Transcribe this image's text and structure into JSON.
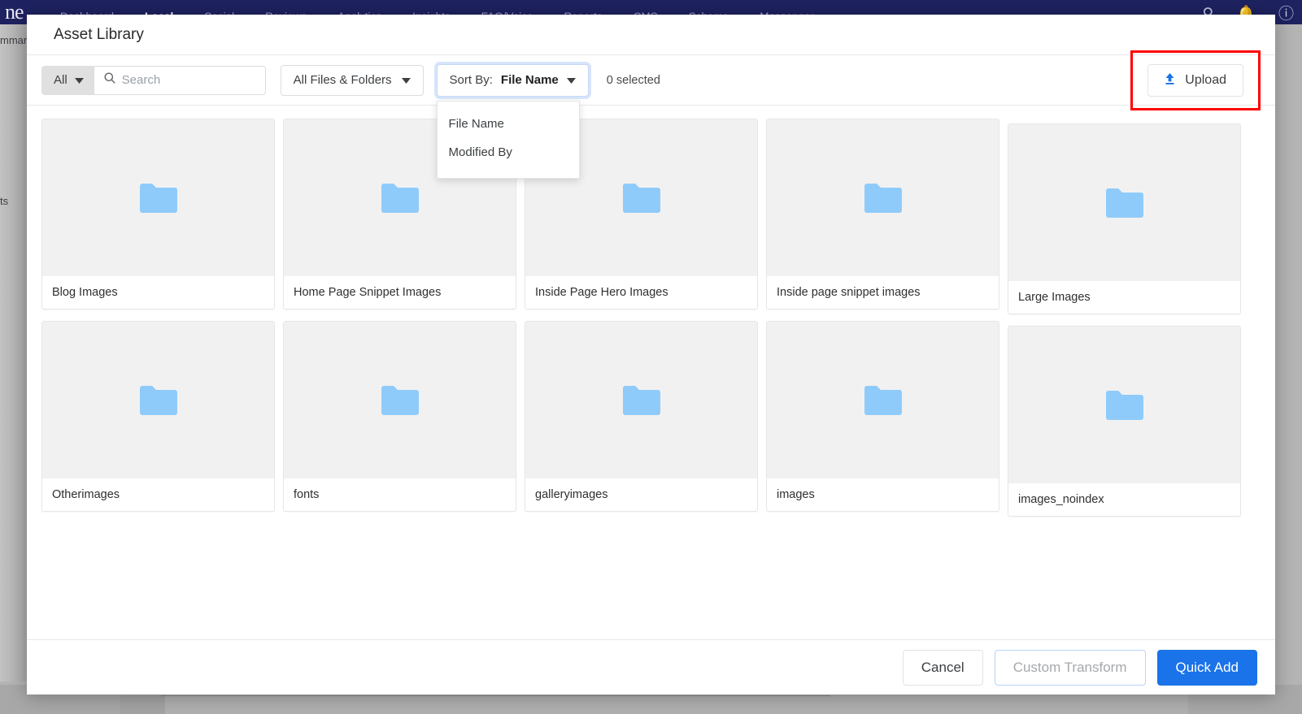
{
  "background": {
    "logo_text": "ne",
    "nav_items": [
      {
        "label": "Dashboard",
        "active": false
      },
      {
        "label": "Local",
        "active": true
      },
      {
        "label": "Social",
        "active": false
      },
      {
        "label": "Reviews",
        "active": false
      },
      {
        "label": "Analytics",
        "active": false
      },
      {
        "label": "Insights",
        "active": false
      },
      {
        "label": "FAQ/Voice",
        "active": false
      },
      {
        "label": "Reports",
        "active": false
      },
      {
        "label": "CMS",
        "active": false
      },
      {
        "label": "Scheme",
        "active": false
      },
      {
        "label": "Messenger",
        "active": false
      }
    ],
    "nav_icons": [
      "search-icon",
      "notification-bell-icon",
      "help-icon"
    ],
    "left_fragment_top": "mmar",
    "left_fragment_bottom": "ts"
  },
  "modal": {
    "title": "Asset Library",
    "toolbar": {
      "all_select_label": "All",
      "search_placeholder": "Search",
      "search_value": "",
      "filter_label": "All Files & Folders",
      "sort_prefix": "Sort By: ",
      "sort_value": "File Name",
      "sort_menu_items": [
        "File Name",
        "Modified By"
      ],
      "selected_count_label": "0 selected",
      "upload_label": "Upload",
      "highlight_color": "#ff0000",
      "focus_ring_color": "#d7e5fb"
    },
    "grid": {
      "rows": [
        [
          {
            "name": "Blog Images",
            "type": "folder"
          },
          {
            "name": "Home Page Snippet Images",
            "type": "folder"
          },
          {
            "name": "Inside Page Hero Images",
            "type": "folder"
          },
          {
            "name": "Inside page snippet images",
            "type": "folder"
          },
          {
            "name": "Large Images",
            "type": "folder"
          }
        ],
        [
          {
            "name": "Otherimages",
            "type": "folder"
          },
          {
            "name": "fonts",
            "type": "folder"
          },
          {
            "name": "galleryimages",
            "type": "folder"
          },
          {
            "name": "images",
            "type": "folder"
          },
          {
            "name": "images_noindex",
            "type": "folder"
          }
        ]
      ],
      "folder_color": "#8fcbfa"
    },
    "footer": {
      "cancel_label": "Cancel",
      "custom_transform_label": "Custom Transform",
      "quick_add_label": "Quick Add",
      "primary_color": "#1a73e8"
    }
  }
}
